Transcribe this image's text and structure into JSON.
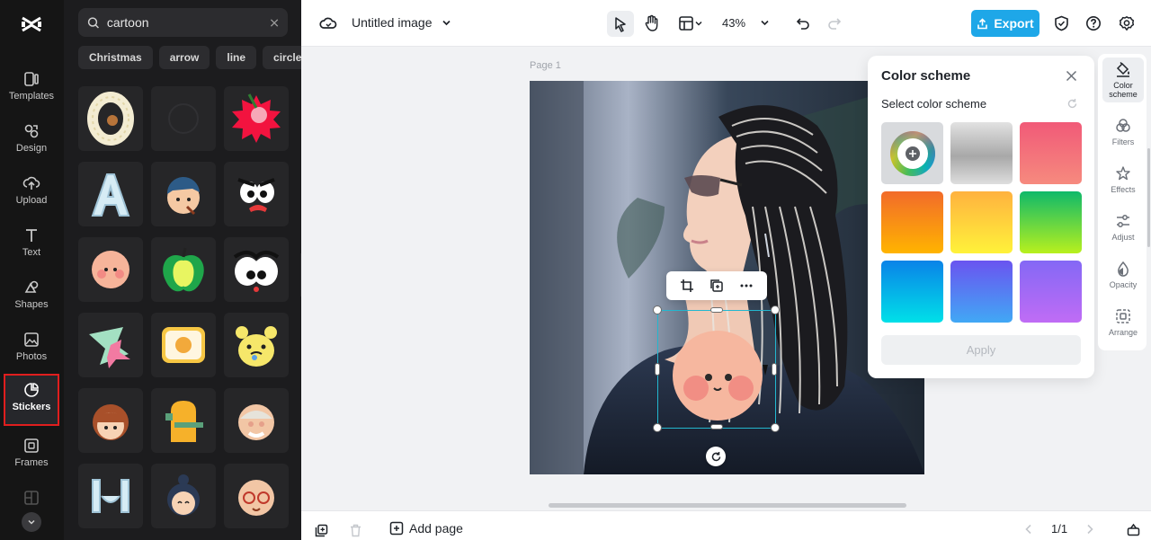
{
  "rail": {
    "items": [
      {
        "label": "Templates",
        "icon": "templates-icon"
      },
      {
        "label": "Design",
        "icon": "design-icon"
      },
      {
        "label": "Upload",
        "icon": "upload-icon"
      },
      {
        "label": "Text",
        "icon": "text-icon"
      },
      {
        "label": "Shapes",
        "icon": "shapes-icon"
      },
      {
        "label": "Photos",
        "icon": "photos-icon"
      },
      {
        "label": "Stickers",
        "icon": "stickers-icon"
      },
      {
        "label": "Frames",
        "icon": "frames-icon"
      }
    ],
    "active": "Stickers"
  },
  "panel": {
    "search_value": "cartoon",
    "chips": [
      "Christmas",
      "arrow",
      "line",
      "circle"
    ]
  },
  "topbar": {
    "title": "Untitled image",
    "zoom": "43%",
    "export_label": "Export"
  },
  "canvas": {
    "page_label": "Page 1"
  },
  "color_scheme": {
    "title": "Color scheme",
    "subtitle": "Select color scheme",
    "apply_label": "Apply",
    "swatches": [
      {
        "name": "custom",
        "color": "#d8dadd"
      },
      {
        "name": "gray",
        "color": "#b8b8b8"
      },
      {
        "name": "pink",
        "color": "#f2637a"
      },
      {
        "name": "orange",
        "color": "#f7941d"
      },
      {
        "name": "yellow",
        "color": "#ffd23a"
      },
      {
        "name": "green",
        "color": "#22c55e"
      },
      {
        "name": "cyan",
        "color": "#12b8e6"
      },
      {
        "name": "blue",
        "color": "#4b7cf2"
      },
      {
        "name": "purple",
        "color": "#a45cf2"
      }
    ]
  },
  "properties": {
    "items": [
      {
        "label": "Color scheme",
        "icon": "paint-bucket-icon"
      },
      {
        "label": "Filters",
        "icon": "filters-icon"
      },
      {
        "label": "Effects",
        "icon": "effects-icon"
      },
      {
        "label": "Adjust",
        "icon": "adjust-icon"
      },
      {
        "label": "Opacity",
        "icon": "opacity-icon"
      },
      {
        "label": "Arrange",
        "icon": "arrange-icon"
      }
    ]
  },
  "bottombar": {
    "add_page_label": "Add page",
    "page_indicator": "1/1"
  },
  "colors": {
    "accent": "#1ea7e8",
    "selection": "#23b7cf",
    "active_outline": "#e01e1e"
  }
}
